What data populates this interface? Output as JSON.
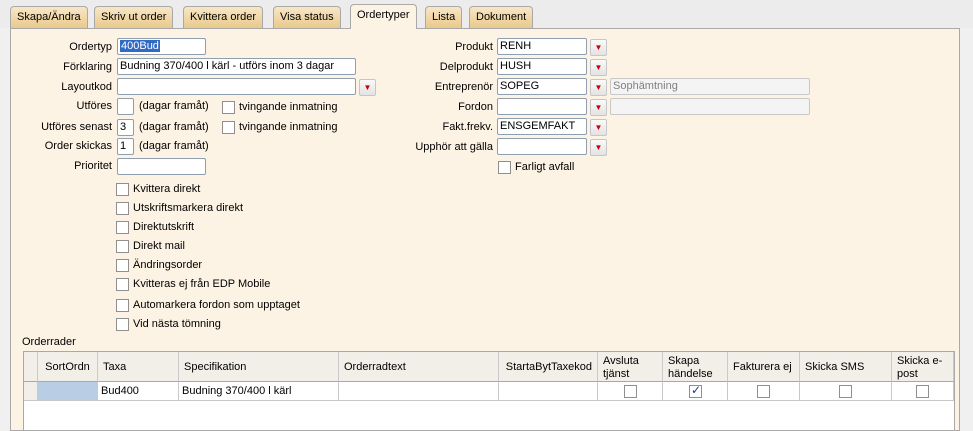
{
  "tabs": [
    "Skapa/Ändra",
    "Skriv ut order",
    "Kvittera order",
    "Visa status",
    "Ordertyper",
    "Lista",
    "Dokument"
  ],
  "active_tab": "Ordertyper",
  "left_form": {
    "ordertyp_label": "Ordertyp",
    "ordertyp_value": "400Bud",
    "forklaring_label": "Förklaring",
    "forklaring_value": "Budning 370/400 l kärl - utförs inom 3 dagar",
    "layoutkod_label": "Layoutkod",
    "layoutkod_value": "",
    "utfores_label": "Utföres",
    "utfores_value": "",
    "utfores_hint": "(dagar framåt)",
    "utfores_forced": "tvingande inmatning",
    "utfores_senast_label": "Utföres senast",
    "utfores_senast_value": "3",
    "utfores_senast_hint": "(dagar framåt)",
    "utfores_senast_forced": "tvingande inmatning",
    "order_skickas_label": "Order skickas",
    "order_skickas_value": "1",
    "order_skickas_hint": "(dagar framåt)",
    "prioritet_label": "Prioritet",
    "prioritet_value": ""
  },
  "right_form": {
    "produkt_label": "Produkt",
    "produkt_value": "RENH",
    "delprodukt_label": "Delprodukt",
    "delprodukt_value": "HUSH",
    "entreprenor_label": "Entreprenör",
    "entreprenor_value": "SOPEG",
    "entreprenor_desc": "Sophämtning",
    "fordon_label": "Fordon",
    "fordon_value": "",
    "fordon_desc": "",
    "fakt_label": "Fakt.frekv.",
    "fakt_value": "ENSGEMFAKT",
    "upphor_label": "Upphör att gälla",
    "upphor_value": "",
    "farligt_label": "Farligt avfall"
  },
  "options": [
    {
      "label": "Kvittera direkt",
      "checked": false
    },
    {
      "label": "Utskriftsmarkera direkt",
      "checked": false
    },
    {
      "label": "Direktutskrift",
      "checked": false
    },
    {
      "label": "Direkt mail",
      "checked": false
    },
    {
      "label": "Ändringsorder",
      "checked": false
    },
    {
      "label": "Kvitteras ej från EDP Mobile",
      "checked": false
    },
    {
      "label": "Automarkera fordon som upptaget",
      "checked": false
    },
    {
      "label": "Vid nästa tömning",
      "checked": false
    }
  ],
  "orderrader": {
    "title": "Orderrader",
    "columns": [
      "SortOrdn",
      "Taxa",
      "Specifikation",
      "Orderradtext",
      "StartaBytTaxekod",
      "Avsluta tjänst",
      "Skapa händelse",
      "Fakturera ej",
      "Skicka SMS",
      "Skicka e-post"
    ],
    "rows": [
      {
        "sortordn": "",
        "taxa": "Bud400",
        "specifikation": "Budning 370/400 l kärl",
        "orderradtext": "",
        "starta": "",
        "avsluta": false,
        "skapa": true,
        "fakturera": false,
        "sms": false,
        "epost": false
      }
    ]
  },
  "colors": {
    "tab_bg": "#e9c98c",
    "panel_bg": "#fdf3e4",
    "selection": "#316ac5",
    "dropdown_arrow": "#cc0000"
  }
}
